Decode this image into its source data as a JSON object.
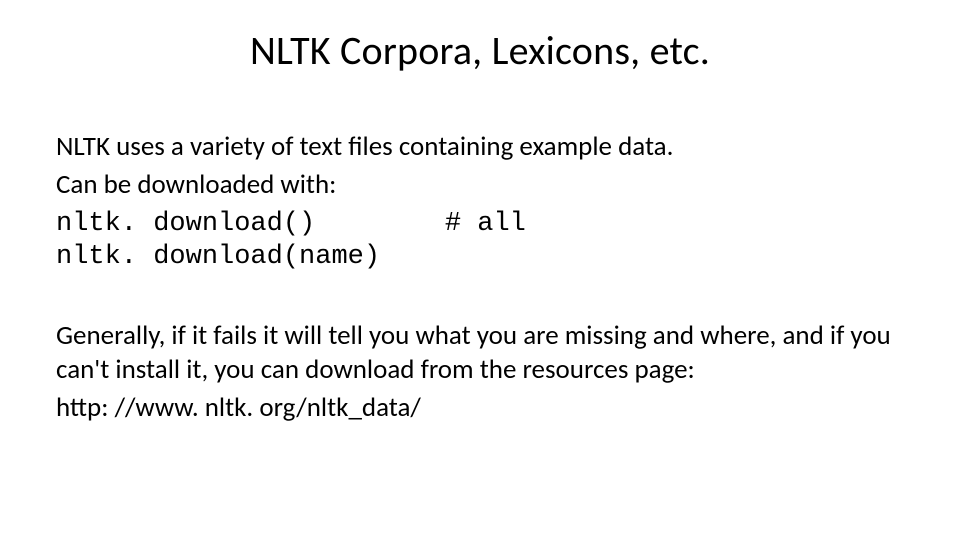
{
  "title": "NLTK Corpora, Lexicons, etc.",
  "intro_line1": "NLTK uses a variety of text files containing example data.",
  "intro_line2": "Can be downloaded with:",
  "code": {
    "line1": "nltk. download()        # all",
    "line2": "nltk. download(name)"
  },
  "para2": "Generally, if it fails it will tell you what you are missing and where, and if you can't install it, you can download from the resources page:",
  "url": "http: //www. nltk. org/nltk_data/"
}
